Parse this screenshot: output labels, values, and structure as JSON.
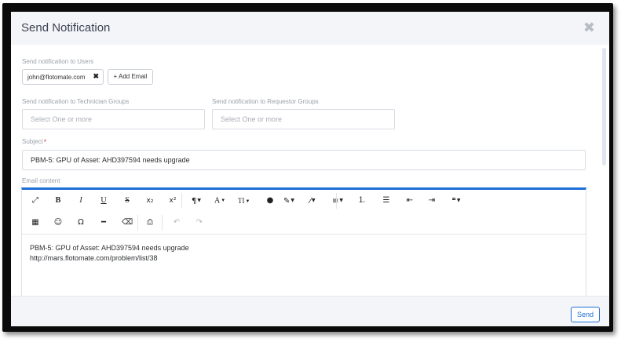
{
  "dialog": {
    "title": "Send Notification",
    "close_icon": "close-icon",
    "close_glyph": "✖"
  },
  "users": {
    "label": "Send notification to Users",
    "chips": [
      {
        "email": "john@flotomate.com",
        "remove_glyph": "✖"
      }
    ],
    "add_email_label": "+ Add Email"
  },
  "technician_groups": {
    "label": "Send notification to Technician Groups",
    "placeholder": "Select One or more"
  },
  "requestor_groups": {
    "label": "Send notification to Requestor Groups",
    "placeholder": "Select One or more"
  },
  "subject": {
    "label": "Subject",
    "required_mark": "*",
    "value": "PBM-5: GPU of Asset: AHD397594 needs upgrade"
  },
  "email_content": {
    "label": "Email content",
    "toolbar_row1": [
      {
        "name": "fullscreen-icon",
        "glyph": "⤢"
      },
      {
        "name": "bold-icon",
        "glyph": "B"
      },
      {
        "name": "italic-icon",
        "glyph": "I"
      },
      {
        "name": "underline-icon",
        "glyph": "U"
      },
      {
        "name": "strikethrough-icon",
        "glyph": "S"
      },
      {
        "name": "subscript-icon",
        "glyph": "x₂"
      },
      {
        "name": "superscript-icon",
        "glyph": "x²"
      },
      {
        "name": "paragraph-format-icon",
        "glyph": "¶"
      },
      {
        "name": "font-family-icon",
        "glyph": "A"
      },
      {
        "name": "font-size-icon",
        "glyph": "TI"
      },
      {
        "name": "color-icon",
        "glyph": "●"
      },
      {
        "name": "brush-icon",
        "glyph": "✎"
      },
      {
        "name": "magic-icon",
        "glyph": "⁄"
      },
      {
        "name": "align-icon",
        "glyph": "≡"
      },
      {
        "name": "ordered-list-icon",
        "glyph": "⒈"
      },
      {
        "name": "unordered-list-icon",
        "glyph": "☰"
      },
      {
        "name": "outdent-icon",
        "glyph": "⇤"
      },
      {
        "name": "indent-icon",
        "glyph": "⇥"
      },
      {
        "name": "quote-icon",
        "glyph": "❝"
      }
    ],
    "toolbar_row2": [
      {
        "name": "table-icon",
        "glyph": "▦"
      },
      {
        "name": "emoticon-icon",
        "glyph": "☺"
      },
      {
        "name": "special-characters-icon",
        "glyph": "Ω"
      },
      {
        "name": "horizontal-line-icon",
        "glyph": "━"
      },
      {
        "name": "clear-formatting-icon",
        "glyph": "⌫"
      },
      {
        "name": "print-icon",
        "glyph": "⎙"
      },
      {
        "name": "undo-icon",
        "glyph": "↶"
      },
      {
        "name": "redo-icon",
        "glyph": "↷"
      }
    ],
    "body_lines": [
      "PBM-5: GPU of Asset: AHD397594 needs upgrade",
      "http://mars.flotomate.com/problem/list/38"
    ]
  },
  "footer": {
    "send_label": "Send"
  },
  "colors": {
    "accent": "#1e6ed8",
    "header_bg": "#f4f5f8",
    "required": "#e0404a"
  }
}
